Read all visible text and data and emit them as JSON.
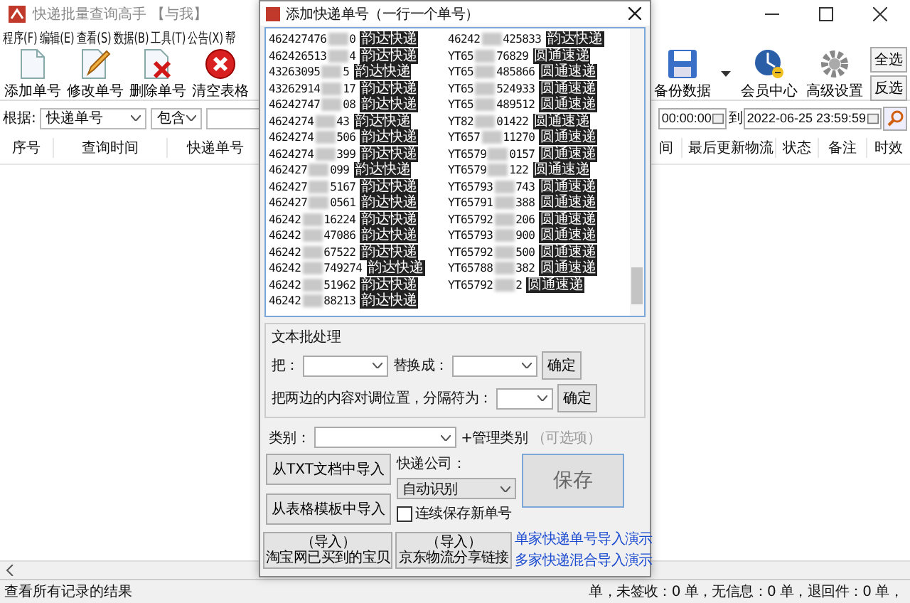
{
  "main_window": {
    "title": "快递批量查询高手 【与我】",
    "menu": [
      "程序(F)",
      "编辑(E)",
      "查看(S)",
      "数据(B)",
      "工具(T)",
      "公告(X)",
      "帮"
    ],
    "toolbar_left": [
      {
        "kind": "add",
        "label": "添加单号"
      },
      {
        "kind": "edit",
        "label": "修改单号"
      },
      {
        "kind": "delete",
        "label": "删除单号"
      },
      {
        "kind": "clear",
        "label": "清空表格"
      }
    ],
    "toolbar_right": [
      {
        "kind": "backup",
        "label": "备份数据"
      },
      {
        "kind": "member",
        "label": "会员中心"
      },
      {
        "kind": "settings",
        "label": "高级设置"
      }
    ],
    "select_buttons": [
      "全选",
      "反选"
    ],
    "filter": {
      "by_label": "根据:",
      "field": "快递单号",
      "match": "包含",
      "time_from": "00:00:00",
      "to_label": "到",
      "time_to": "2022-06-25 23:59:59"
    },
    "columns_left": [
      "序号",
      "查询时间",
      "快递单号"
    ],
    "columns_right": [
      "间",
      "最后更新物流",
      "状态",
      "备注",
      "时效"
    ],
    "status_left": "查看所有记录的结果",
    "status_right": "单，未签收：0 单，无信息：0 单，退回件：0 单，"
  },
  "dialog": {
    "title": "添加快递单号（一行一个单号）",
    "lines": [
      {
        "start": "462427476",
        "end": "0",
        "company": "韵达快递"
      },
      {
        "start": "462426513",
        "end": "4",
        "company": "韵达快递"
      },
      {
        "start": "43263095",
        "end": "5",
        "company": "韵达快递"
      },
      {
        "start": "43262914",
        "end": "17",
        "company": "韵达快递"
      },
      {
        "start": "46242747",
        "end": "08",
        "company": "韵达快递"
      },
      {
        "start": "4624274",
        "end": "43",
        "company": "韵达快递"
      },
      {
        "start": "4624274",
        "end": "506",
        "company": "韵达快递"
      },
      {
        "start": "4624274",
        "end": "399",
        "company": "韵达快递"
      },
      {
        "start": "462427",
        "end": "099",
        "company": "韵达快递"
      },
      {
        "start": "462427",
        "end": "5167",
        "company": "韵达快递"
      },
      {
        "start": "462427",
        "end": "0561",
        "company": "韵达快递"
      },
      {
        "start": "46242",
        "end": "16224",
        "company": "韵达快递"
      },
      {
        "start": "46242",
        "end": "47086",
        "company": "韵达快递"
      },
      {
        "start": "46242",
        "end": "67522",
        "company": "韵达快递"
      },
      {
        "start": "46242",
        "end": "749274",
        "company": "韵达快递"
      },
      {
        "start": "46242",
        "end": "51962",
        "company": "韵达快递"
      },
      {
        "start": "46242",
        "end": "88213",
        "company": "韵达快递"
      },
      {
        "start": "46242",
        "end": "425833",
        "company": "韵达快递"
      },
      {
        "start": "YT65",
        "end": "76829",
        "company": "圆通速递"
      },
      {
        "start": "YT65",
        "end": "485866",
        "company": "圆通速递"
      },
      {
        "start": "YT65",
        "end": "524933",
        "company": "圆通速递"
      },
      {
        "start": "YT65",
        "end": "489512",
        "company": "圆通速递"
      },
      {
        "start": "YT82",
        "end": "01422",
        "company": "圆通速递"
      },
      {
        "start": "YT657",
        "end": "11270",
        "company": "圆通速递"
      },
      {
        "start": "YT6579",
        "end": "0157",
        "company": "圆通速递"
      },
      {
        "start": "YT6579",
        "end": "122",
        "company": "圆通速递"
      },
      {
        "start": "YT65793",
        "end": "743",
        "company": "圆通速递"
      },
      {
        "start": "YT65791",
        "end": "388",
        "company": "圆通速递"
      },
      {
        "start": "YT65792",
        "end": "206",
        "company": "圆通速递"
      },
      {
        "start": "YT65793",
        "end": "900",
        "company": "圆通速递"
      },
      {
        "start": "YT65792",
        "end": "500",
        "company": "圆通速递"
      },
      {
        "start": "YT65788",
        "end": "382",
        "company": "圆通速递"
      },
      {
        "start": "YT65792",
        "end": "2",
        "company": "圆通速递"
      }
    ],
    "batch": {
      "title": "文本批处理",
      "find_label": "把：",
      "replace_label": "替换成：",
      "confirm": "确定",
      "swap_label": "把两边的内容对调位置，分隔符为：",
      "swap_confirm": "确定"
    },
    "category_label": "类别：",
    "manage_category": "+管理类别",
    "optional": "（可选项）",
    "import_txt": "从TXT文档中导入",
    "import_sheet": "从表格模板中导入",
    "company_label": "快递公司：",
    "company": "自动识别",
    "continuous": {
      "label": "连续保存新单号",
      "checked": false
    },
    "save": "保存",
    "links": [
      "单家快递单号导入演示",
      "多家快递混合导入演示"
    ],
    "import_buttons": [
      {
        "top": "（导入）",
        "bottom": "淘宝网已买到的宝贝"
      },
      {
        "top": "（导入）",
        "bottom": "京东物流分享链接"
      }
    ]
  }
}
